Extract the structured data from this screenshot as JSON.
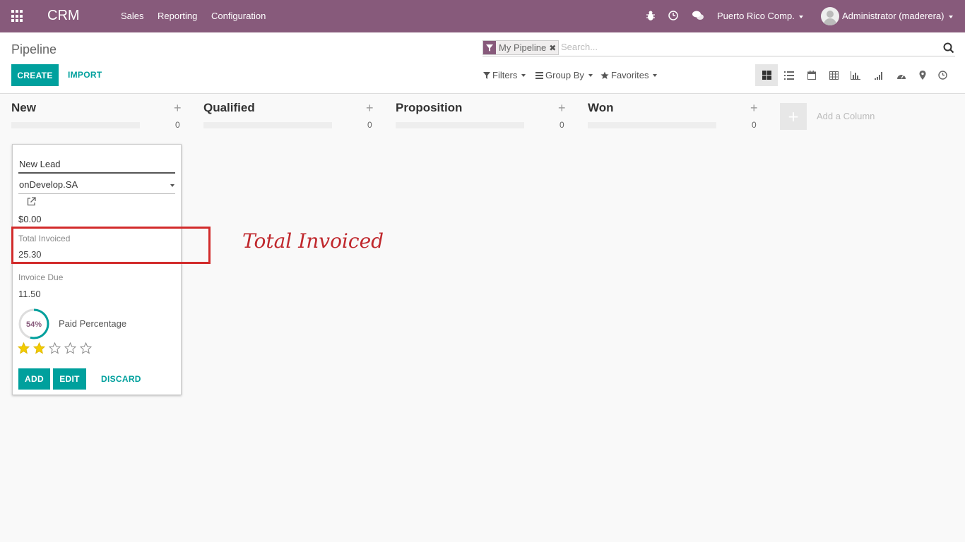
{
  "navbar": {
    "brand": "CRM",
    "menu": [
      "Sales",
      "Reporting",
      "Configuration"
    ],
    "company": "Puerto Rico Comp.",
    "user": "Administrator (maderera)",
    "color": "#875a7b"
  },
  "control": {
    "breadcrumb": "Pipeline",
    "create_label": "CREATE",
    "import_label": "IMPORT",
    "search": {
      "facet": "My Pipeline",
      "placeholder": "Search..."
    },
    "filters_label": "Filters",
    "groupby_label": "Group By",
    "favorites_label": "Favorites",
    "views": [
      "kanban-icon",
      "list-icon",
      "calendar-icon",
      "pivot-icon",
      "graph-icon",
      "cohort-icon",
      "dashboard-icon",
      "map-icon",
      "activity-icon"
    ],
    "accent": "#00a09d"
  },
  "kanban": {
    "columns": [
      {
        "name": "New",
        "count": "0"
      },
      {
        "name": "Qualified",
        "count": "0"
      },
      {
        "name": "Proposition",
        "count": "0"
      },
      {
        "name": "Won",
        "count": "0"
      }
    ],
    "add_column_label": "Add a Column"
  },
  "card": {
    "title": "New Lead",
    "partner": "onDevelop.SA",
    "revenue": "$0.00",
    "total_invoiced_label": "Total Invoiced",
    "total_invoiced_value": "25.30",
    "invoice_due_label": "Invoice Due",
    "invoice_due_value": "11.50",
    "paid_percentage": "54%",
    "paid_percentage_fraction": 0.54,
    "paid_percentage_label": "Paid Percentage",
    "priority_stars": 2,
    "priority_max": 5,
    "add_label": "ADD",
    "edit_label": "EDIT",
    "discard_label": "DISCARD"
  },
  "annotation": {
    "text": "Total Invoiced",
    "color": "#c0282d"
  }
}
